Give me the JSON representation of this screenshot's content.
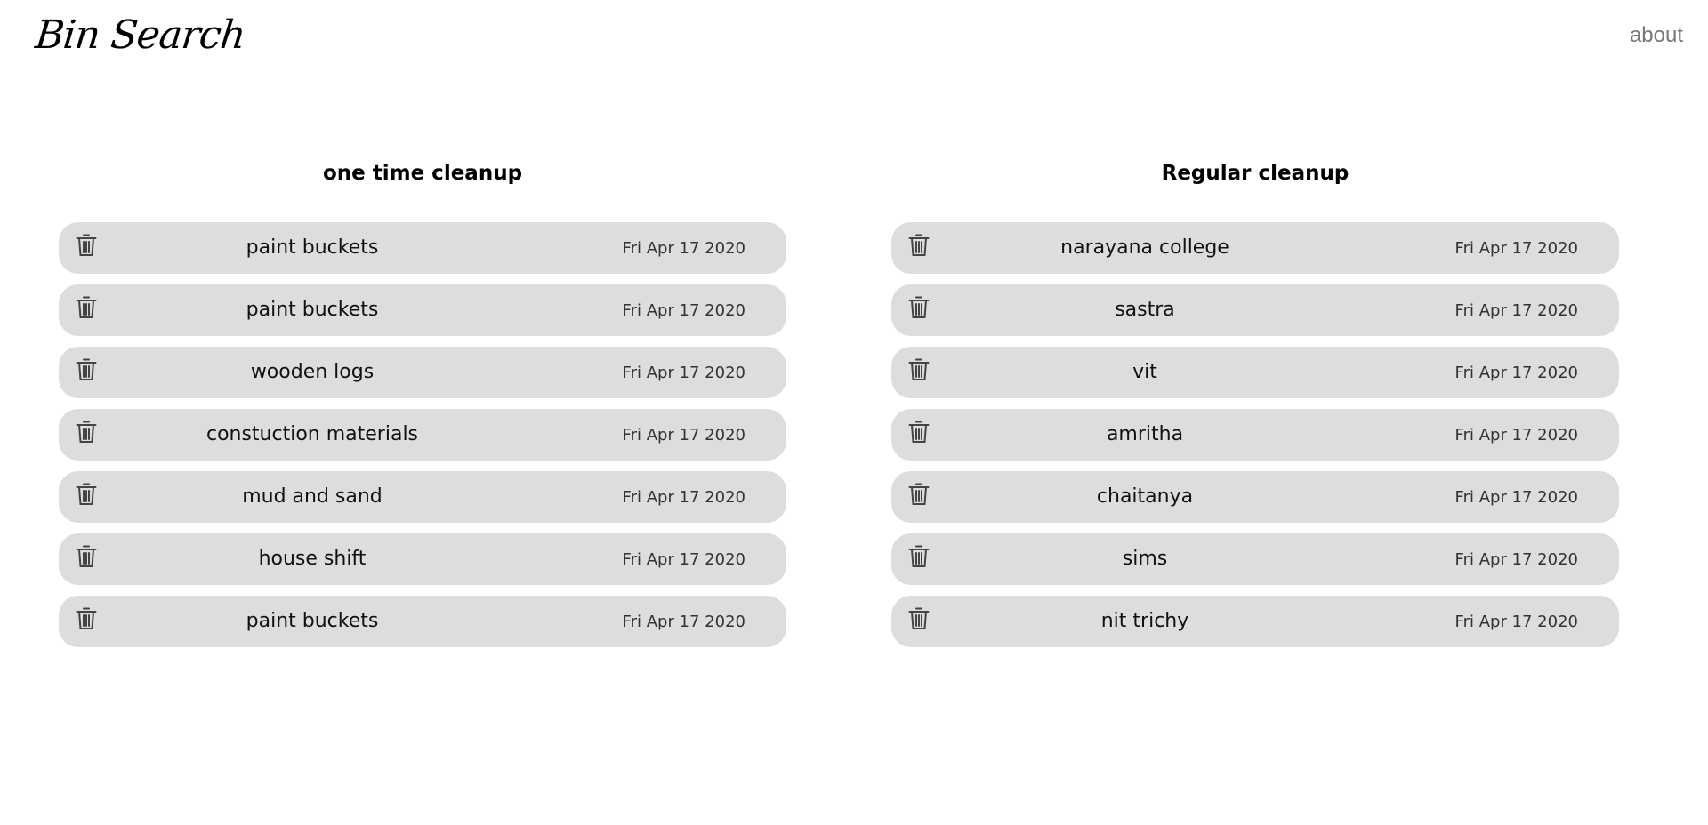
{
  "header": {
    "brand": "Bin Search",
    "about_label": "about"
  },
  "columns": [
    {
      "title": "one time cleanup",
      "items": [
        {
          "name": "paint buckets",
          "date": "Fri Apr 17 2020"
        },
        {
          "name": "paint buckets",
          "date": "Fri Apr 17 2020"
        },
        {
          "name": "wooden logs",
          "date": "Fri Apr 17 2020"
        },
        {
          "name": "constuction materials",
          "date": "Fri Apr 17 2020"
        },
        {
          "name": "mud and sand",
          "date": "Fri Apr 17 2020"
        },
        {
          "name": "house shift",
          "date": "Fri Apr 17 2020"
        },
        {
          "name": "paint buckets",
          "date": "Fri Apr 17 2020"
        }
      ]
    },
    {
      "title": "Regular cleanup",
      "items": [
        {
          "name": "narayana college",
          "date": "Fri Apr 17 2020"
        },
        {
          "name": "sastra",
          "date": "Fri Apr 17 2020"
        },
        {
          "name": "vit",
          "date": "Fri Apr 17 2020"
        },
        {
          "name": "amritha",
          "date": "Fri Apr 17 2020"
        },
        {
          "name": "chaitanya",
          "date": "Fri Apr 17 2020"
        },
        {
          "name": "sims",
          "date": "Fri Apr 17 2020"
        },
        {
          "name": "nit trichy",
          "date": "Fri Apr 17 2020"
        }
      ]
    }
  ],
  "icons": {
    "delete": "trash-icon"
  },
  "colors": {
    "row_background": "#dddddd",
    "about_link": "#777777",
    "text": "#000000"
  }
}
